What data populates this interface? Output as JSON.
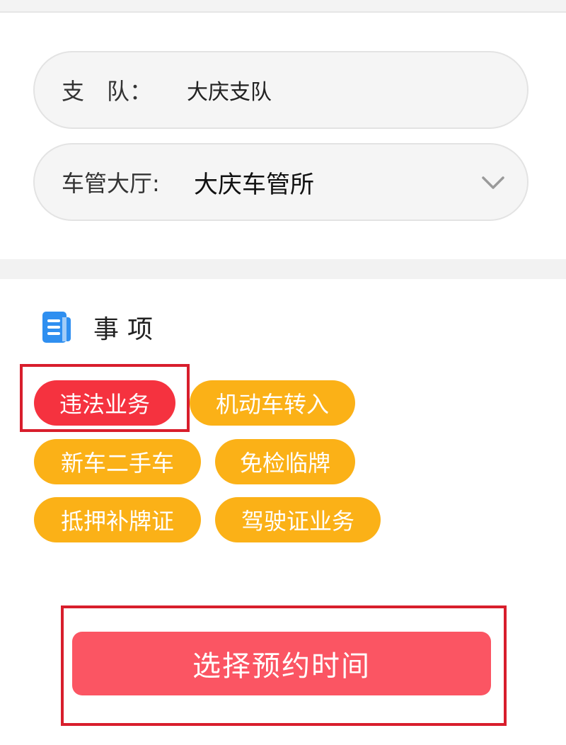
{
  "form": {
    "branch": {
      "label": "支　队：",
      "value": "大庆支队"
    },
    "hall": {
      "label": "车管大厅:",
      "value": "大庆车管所"
    }
  },
  "section": {
    "title": "事项"
  },
  "chips": [
    {
      "label": "违法业务",
      "selected": true
    },
    {
      "label": "机动车转入",
      "selected": false
    },
    {
      "label": "新车二手车",
      "selected": false
    },
    {
      "label": "免检临牌",
      "selected": false
    },
    {
      "label": "抵押补牌证",
      "selected": false
    },
    {
      "label": "驾驶证业务",
      "selected": false
    }
  ],
  "actions": {
    "primary_label": "选择预约时间"
  },
  "colors": {
    "chip_selected": "#f5323f",
    "chip_default": "#fbb117",
    "primary_button": "#fb5563",
    "highlight_border": "#d81e2c",
    "section_icon": "#2f8ff0"
  },
  "icons": {
    "section": "document-list-icon",
    "dropdown": "chevron-down-icon"
  }
}
